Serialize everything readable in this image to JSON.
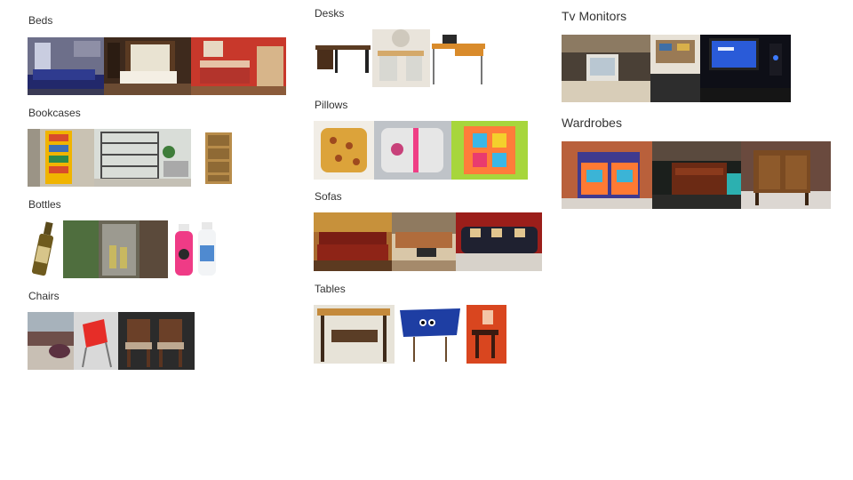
{
  "categories": {
    "beds": "Beds",
    "bookcases": "Bookcases",
    "bottles": "Bottles",
    "chairs": "Chairs",
    "desks": "Desks",
    "pillows": "Pillows",
    "sofas": "Sofas",
    "tables": "Tables",
    "tv_monitors": "Tv Monitors",
    "wardrobes": "Wardrobes"
  }
}
